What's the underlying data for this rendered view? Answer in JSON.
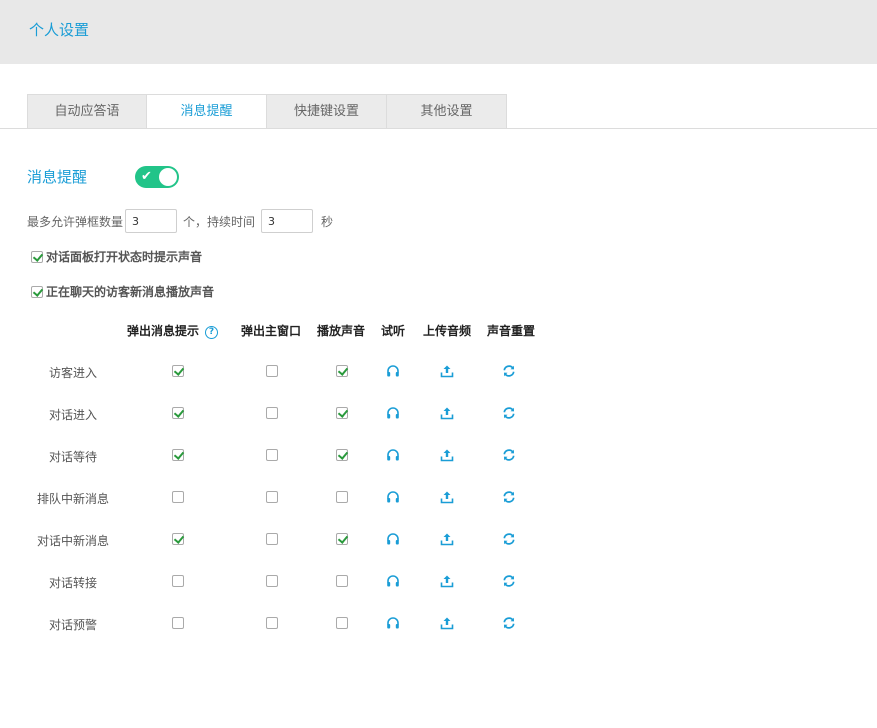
{
  "header": {
    "title": "个人设置"
  },
  "tabs": [
    {
      "label": "自动应答语",
      "active": false
    },
    {
      "label": "消息提醒",
      "active": true
    },
    {
      "label": "快捷键设置",
      "active": false
    },
    {
      "label": "其他设置",
      "active": false
    }
  ],
  "section": {
    "title": "消息提醒",
    "enabled": true
  },
  "limits": {
    "prefix": "最多允许弹框数量",
    "max_popups": "3",
    "middle": "个，持续时间",
    "duration": "3",
    "suffix": "秒"
  },
  "options": [
    {
      "label": "对话面板打开状态时提示声音",
      "checked": true
    },
    {
      "label": "正在聊天的访客新消息播放声音",
      "checked": true
    }
  ],
  "table": {
    "columns": [
      "弹出消息提示",
      "弹出主窗口",
      "播放声音",
      "试听",
      "上传音频",
      "声音重置"
    ],
    "help_icon": "?",
    "rows": [
      {
        "label": "访客进入",
        "popup": true,
        "main_window": false,
        "sound": true
      },
      {
        "label": "对话进入",
        "popup": true,
        "main_window": false,
        "sound": true
      },
      {
        "label": "对话等待",
        "popup": true,
        "main_window": false,
        "sound": true
      },
      {
        "label": "排队中新消息",
        "popup": false,
        "main_window": false,
        "sound": false
      },
      {
        "label": "对话中新消息",
        "popup": true,
        "main_window": false,
        "sound": true
      },
      {
        "label": "对话转接",
        "popup": false,
        "main_window": false,
        "sound": false
      },
      {
        "label": "对话预警",
        "popup": false,
        "main_window": false,
        "sound": false
      }
    ],
    "icons": {
      "preview": "headphones-icon",
      "upload": "upload-icon",
      "reset": "refresh-icon"
    }
  },
  "colors": {
    "accent": "#1a9dd6",
    "toggle_on": "#22c489",
    "check": "#2a9a3c",
    "header_bg": "#e8e8e8"
  }
}
